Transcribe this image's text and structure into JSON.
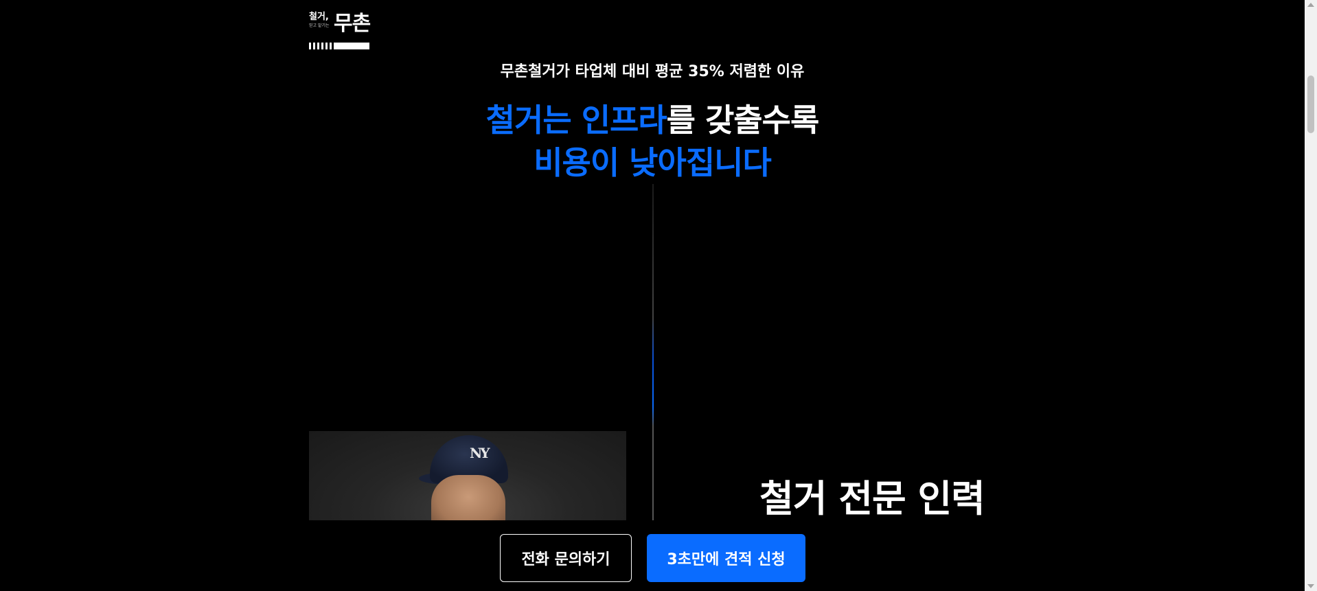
{
  "logo": {
    "small_text": "철거,",
    "tiny_text": "믿고 맡기는",
    "big_text": "무촌"
  },
  "hero": {
    "subtitle": "무촌철거가 타업체 대비 평균 35% 저렴한 이유",
    "headline_line1_blue": "철거는 인프라",
    "headline_line1_white": "를 갖출수록",
    "headline_line2_blue": "비용이 낮아집니다"
  },
  "feature": {
    "title": "철거 전문 인력",
    "photo_cap_logo": "NY"
  },
  "cta": {
    "phone_label": "전화 문의하기",
    "quote_label": "3초만에 견적 신청"
  },
  "colors": {
    "accent": "#0a6cff",
    "background": "#000000",
    "text": "#ffffff"
  },
  "icons": {
    "scroll_up": "chevron-up-icon",
    "scroll_down": "chevron-down-icon"
  }
}
